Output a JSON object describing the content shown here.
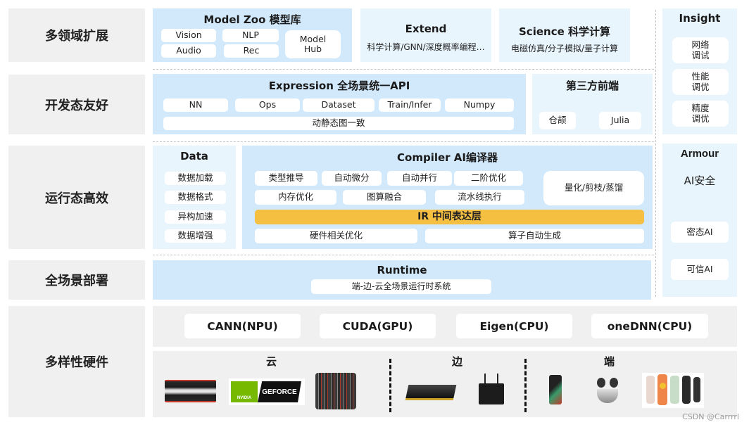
{
  "rows": [
    {
      "label": "多领域扩展"
    },
    {
      "label": "开发态友好"
    },
    {
      "label": "运行态高效"
    },
    {
      "label": "全场景部署"
    },
    {
      "label": "多样性硬件"
    }
  ],
  "model_zoo": {
    "title": "Model Zoo 模型库",
    "items": [
      "Vision",
      "NLP",
      "Audio",
      "Rec",
      "Model\nHub"
    ]
  },
  "extend": {
    "title": "Extend",
    "subtitle": "科学计算/GNN/深度概率编程…"
  },
  "science": {
    "title": "Science 科学计算",
    "subtitle": "电磁仿真/分子模拟/量子计算"
  },
  "expression": {
    "title": "Expression 全场景统一API",
    "items": [
      "NN",
      "Ops",
      "Dataset",
      "Train/Infer",
      "Numpy"
    ],
    "bottom": "动静态图一致"
  },
  "third_party": {
    "title": "第三方前端",
    "items": [
      "仓颉",
      "Julia"
    ]
  },
  "data_panel": {
    "title": "Data",
    "items": [
      "数据加载",
      "数据格式",
      "异构加速",
      "数据增强"
    ]
  },
  "compiler": {
    "title": "Compiler AI编译器",
    "row1": [
      "类型推导",
      "自动微分",
      "自动并行",
      "二阶优化"
    ],
    "row2": [
      "内存优化",
      "图算融合",
      "流水线执行"
    ],
    "side": "量化/剪枝/蒸馏",
    "ir": "IR 中间表达层",
    "row3": [
      "硬件相关优化",
      "算子自动生成"
    ],
    "ir_color": "#f5bf42"
  },
  "runtime": {
    "title": "Runtime",
    "subtitle": "端-边-云全场景运行时系统"
  },
  "insight": {
    "title": "Insight",
    "items": [
      "网络\n调试",
      "性能\n调优",
      "精度\n调优"
    ]
  },
  "armour": {
    "title": "Armour",
    "subtitle": "AI安全",
    "items": [
      "密态AI",
      "可信AI"
    ]
  },
  "hardware": {
    "backends": [
      "CANN(NPU)",
      "CUDA(GPU)",
      "Eigen(CPU)",
      "oneDNN(CPU)"
    ],
    "groups": [
      {
        "label": "云",
        "devices": [
          "server-image",
          "nvidia-geforce-image",
          "server-rack-image"
        ]
      },
      {
        "label": "边",
        "devices": [
          "accelerator-card-image",
          "edge-box-image"
        ]
      },
      {
        "label": "端",
        "devices": [
          "phone-image",
          "earbuds-image",
          "smartwatch-image"
        ]
      }
    ],
    "geforce_text": "GEFORCE",
    "nvidia_text": "NVIDIA"
  },
  "watermark": "CSDN @Carrrrl"
}
